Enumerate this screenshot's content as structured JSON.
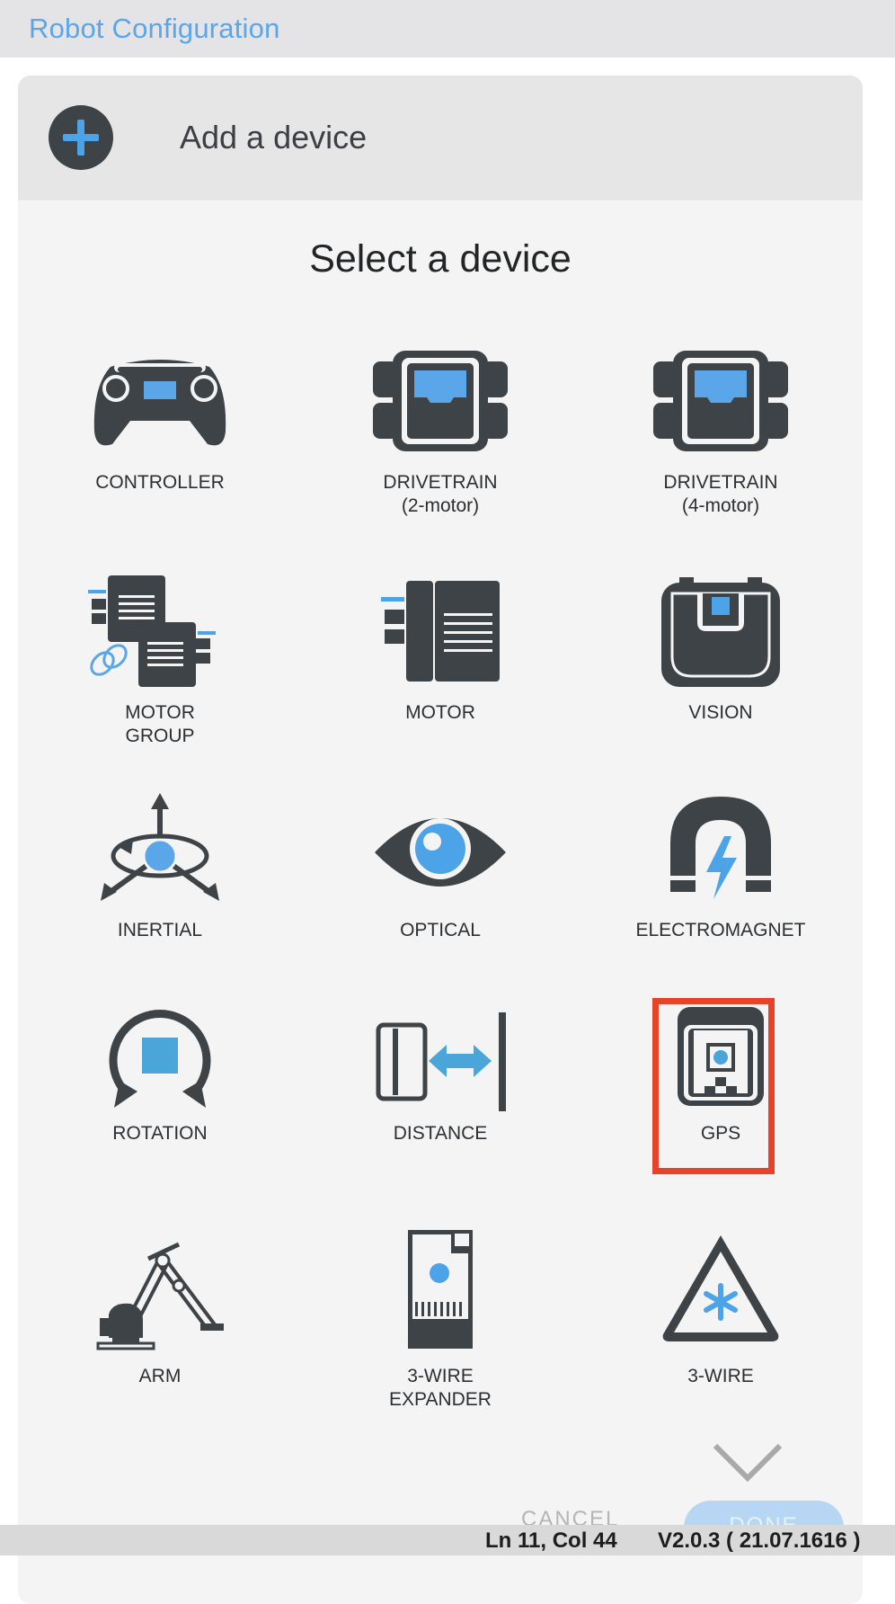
{
  "window": {
    "title": "Robot Configuration"
  },
  "header": {
    "add_label": "Add a device"
  },
  "picker": {
    "title": "Select a device",
    "devices": [
      {
        "line1": "CONTROLLER",
        "line2": "",
        "icon": "controller-icon"
      },
      {
        "line1": "DRIVETRAIN",
        "line2": "(2-motor)",
        "icon": "drivetrain-icon"
      },
      {
        "line1": "DRIVETRAIN",
        "line2": "(4-motor)",
        "icon": "drivetrain-icon"
      },
      {
        "line1": "MOTOR",
        "line2": "GROUP",
        "icon": "motor-group-icon"
      },
      {
        "line1": "MOTOR",
        "line2": "",
        "icon": "motor-icon"
      },
      {
        "line1": "VISION",
        "line2": "",
        "icon": "vision-icon"
      },
      {
        "line1": "INERTIAL",
        "line2": "",
        "icon": "inertial-icon"
      },
      {
        "line1": "OPTICAL",
        "line2": "",
        "icon": "eye-icon"
      },
      {
        "line1": "ELECTROMAGNET",
        "line2": "",
        "icon": "magnet-icon"
      },
      {
        "line1": "ROTATION",
        "line2": "",
        "icon": "rotation-icon"
      },
      {
        "line1": "DISTANCE",
        "line2": "",
        "icon": "distance-icon"
      },
      {
        "line1": "GPS",
        "line2": "",
        "icon": "gps-icon"
      },
      {
        "line1": "ARM",
        "line2": "",
        "icon": "robot-arm-icon"
      },
      {
        "line1": "3-WIRE",
        "line2": "EXPANDER",
        "icon": "expander-icon"
      },
      {
        "line1": "3-WIRE",
        "line2": "",
        "icon": "three-wire-icon"
      }
    ],
    "selected": "GPS"
  },
  "footer": {
    "cancel_label": "CANCEL",
    "done_label": "DONE"
  },
  "status": {
    "position": "Ln 11, Col 44",
    "version": "V2.0.3 ( 21.07.1616 )"
  },
  "colors": {
    "accent": "#4da3e8",
    "icon_dark": "#3e4347",
    "highlight": "#e8432a"
  }
}
